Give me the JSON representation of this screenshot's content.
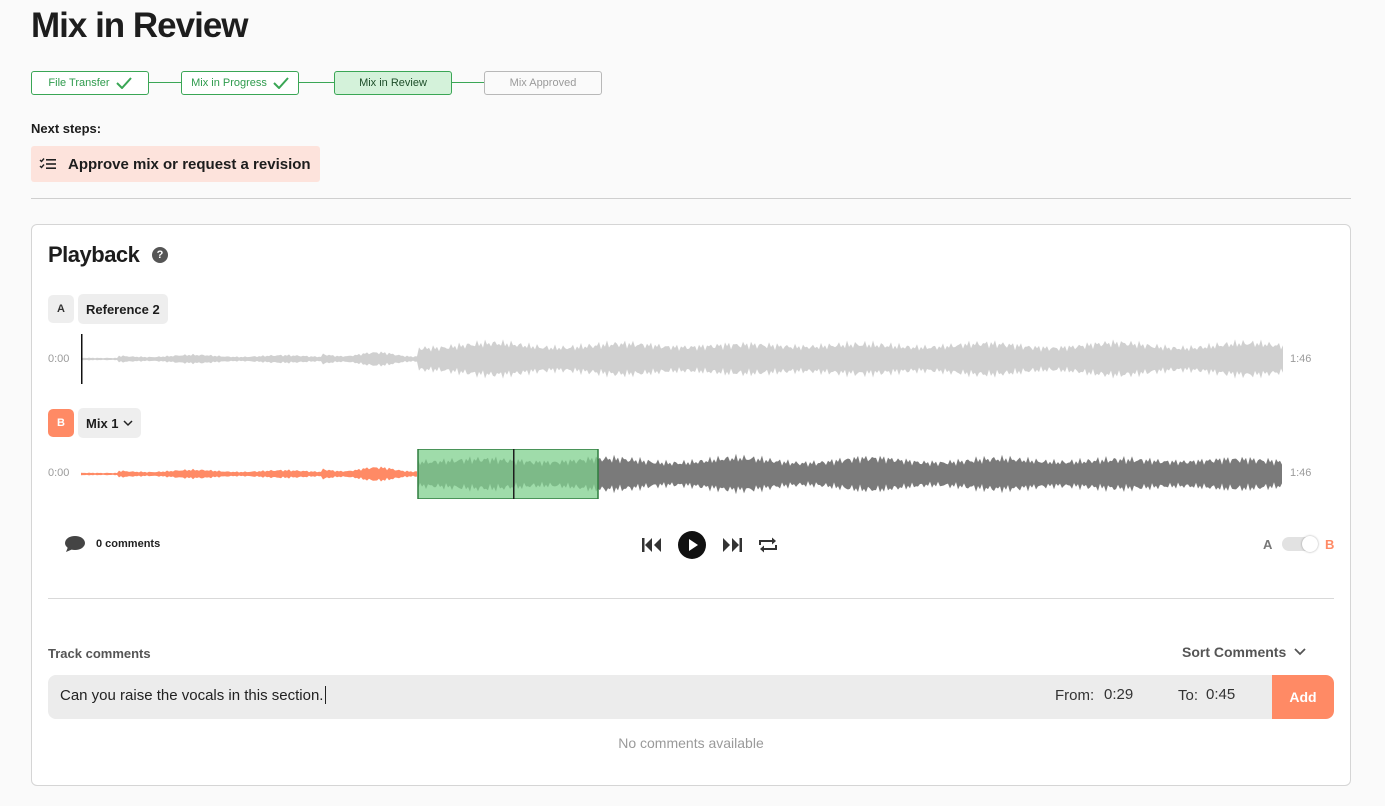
{
  "page": {
    "title": "Mix in Review"
  },
  "progress": {
    "steps": [
      {
        "label": "File Transfer",
        "state": "complete"
      },
      {
        "label": "Mix in Progress",
        "state": "complete"
      },
      {
        "label": "Mix in Review",
        "state": "current"
      },
      {
        "label": "Mix Approved",
        "state": "pending"
      }
    ]
  },
  "next_steps": {
    "label": "Next steps:",
    "item": "Approve mix or request a revision",
    "icon": "checklist-icon"
  },
  "playback": {
    "title": "Playback",
    "help_icon": "?",
    "track_a": {
      "badge": "A",
      "name": "Reference 2",
      "start": "0:00",
      "end": "1:46"
    },
    "track_b": {
      "badge": "B",
      "name": "Mix 1",
      "start": "0:00",
      "end": "1:46",
      "played_fraction": 0.28,
      "selection": {
        "from": 0.28,
        "to": 0.43
      }
    },
    "comments_count": "0 comments",
    "ab": {
      "a": "A",
      "b": "B",
      "selected": "B"
    }
  },
  "track_comments": {
    "label": "Track comments",
    "sort_label": "Sort Comments",
    "input_value": "Can you raise the vocals in this section.",
    "from_label": "From:",
    "from_value": "0:29",
    "to_label": "To:",
    "to_value": "0:45",
    "add_label": "Add",
    "empty_text": "No comments available"
  },
  "colors": {
    "accent": "#ff8a65",
    "green": "#3aa655",
    "wave_idle": "#d0d0d0",
    "wave_rest": "#7a7a7a",
    "selection": "#7fd08e"
  }
}
